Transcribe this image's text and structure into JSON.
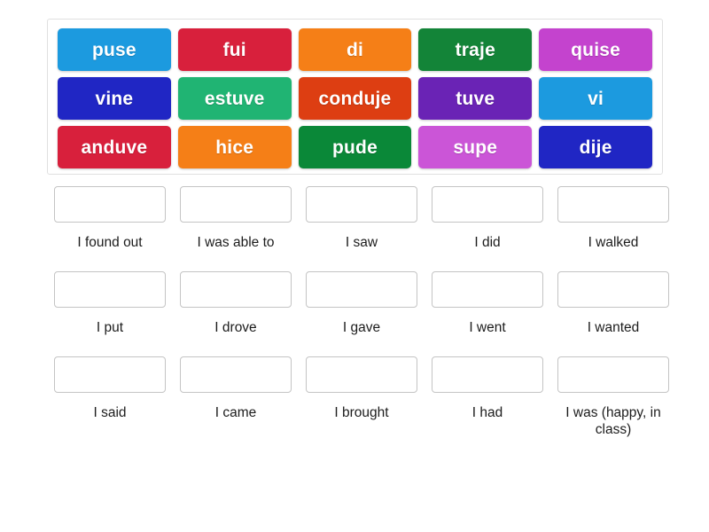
{
  "activity": {
    "type": "match-up",
    "tile_bank": {
      "rows": [
        [
          {
            "label": "puse",
            "color": "#1C9ADF"
          },
          {
            "label": "fui",
            "color": "#D8203C"
          },
          {
            "label": "di",
            "color": "#F57F17"
          },
          {
            "label": "traje",
            "color": "#138438"
          },
          {
            "label": "quise",
            "color": "#C443CE"
          }
        ],
        [
          {
            "label": "vine",
            "color": "#2026C4"
          },
          {
            "label": "estuve",
            "color": "#20B473"
          },
          {
            "label": "conduje",
            "color": "#DD3E12"
          },
          {
            "label": "tuve",
            "color": "#6A23B5"
          },
          {
            "label": "vi",
            "color": "#1C9ADF"
          }
        ],
        [
          {
            "label": "anduve",
            "color": "#D8203C"
          },
          {
            "label": "hice",
            "color": "#F57F17"
          },
          {
            "label": "pude",
            "color": "#0A8838"
          },
          {
            "label": "supe",
            "color": "#CB55D7"
          },
          {
            "label": "dije",
            "color": "#2026C4"
          }
        ]
      ]
    },
    "answers": {
      "rows": [
        [
          {
            "slot_value": "",
            "label": "I found out"
          },
          {
            "slot_value": "",
            "label": "I was able to"
          },
          {
            "slot_value": "",
            "label": "I saw"
          },
          {
            "slot_value": "",
            "label": "I did"
          },
          {
            "slot_value": "",
            "label": "I walked"
          }
        ],
        [
          {
            "slot_value": "",
            "label": "I put"
          },
          {
            "slot_value": "",
            "label": "I drove"
          },
          {
            "slot_value": "",
            "label": "I gave"
          },
          {
            "slot_value": "",
            "label": "I went"
          },
          {
            "slot_value": "",
            "label": "I wanted"
          }
        ],
        [
          {
            "slot_value": "",
            "label": "I said"
          },
          {
            "slot_value": "",
            "label": "I came"
          },
          {
            "slot_value": "",
            "label": "I brought"
          },
          {
            "slot_value": "",
            "label": "I had"
          },
          {
            "slot_value": "",
            "label": "I was (happy, in class)"
          }
        ]
      ]
    },
    "colors": {
      "background": "#ffffff",
      "bank_border": "#e0e0e0",
      "slot_border": "#c4c4c4",
      "label_text": "#1c1c1c",
      "tile_text": "#ffffff"
    }
  }
}
